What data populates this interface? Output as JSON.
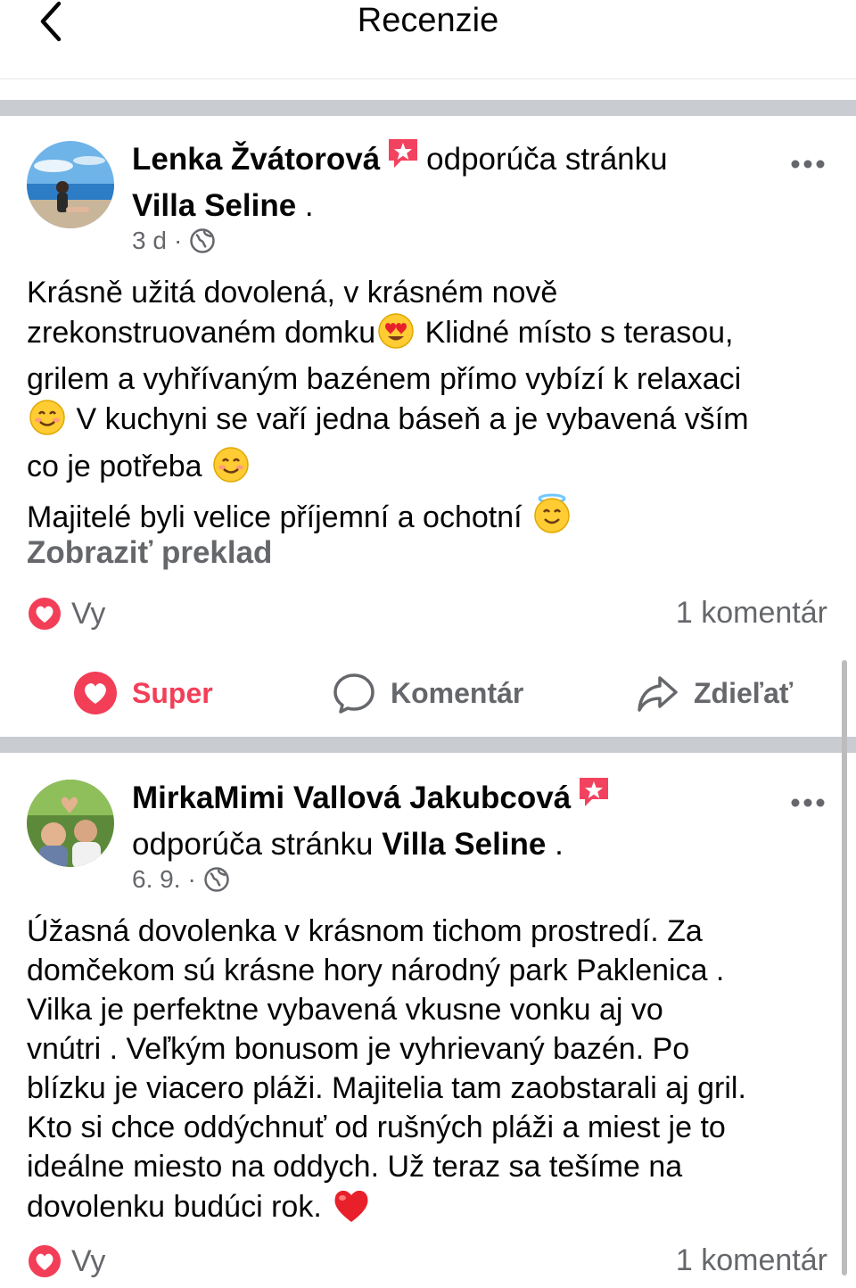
{
  "header": {
    "title": "Recenzie",
    "back_icon": "chevron-left-icon"
  },
  "colors": {
    "separator": "#c9ccd1",
    "love": "#f33e58",
    "muted": "#65676b",
    "badge": "#f3425f"
  },
  "posts": [
    {
      "author": "Lenka Žvátorová",
      "recommends_text": "odporúča stránku",
      "page_name": "Villa Seline",
      "page_suffix": ".",
      "time": "3 d",
      "dot": "·",
      "lines": [
        "Krásně užitá dovolená, v krásném nově",
        "zrekonstruovaném domku",
        " Klidné místo s terasou,",
        "grilem a vyhřívaným bazénem přímo vybízí k relaxaci",
        " V kuchyni se vaří jedna báseň a je vybavená vším",
        "co je potřeba ",
        "Majitelé byli velice příjemní a ochotní "
      ],
      "see_translation": "Zobraziť preklad",
      "reactions_label": "Vy",
      "comments_count": "1 komentár",
      "actions": {
        "like": "Super",
        "comment": "Komentár",
        "share": "Zdieľať"
      }
    },
    {
      "author": "MirkaMimi Vallová Jakubcová",
      "recommends_text": "odporúča stránku",
      "page_name": "Villa Seline",
      "page_suffix": ".",
      "time": "6. 9.",
      "dot": "·",
      "lines": [
        "Úžasná dovolenka v krásnom tichom  prostredí. Za",
        "domčekom sú krásne hory národný park Paklenica .",
        "Vilka je perfektne vybavená vkusne vonku aj vo",
        "vnútri . Veľkým bonusom je vyhrievaný bazén. Po",
        "blízku je viacero pláži. Majitelia tam zaobstarali aj gril.",
        "Kto si chce oddýchnuť od rušných pláži a miest je to",
        "ideálne miesto na oddych. Už teraz sa tešíme na",
        "dovolenku budúci rok. "
      ],
      "reactions_label": "Vy",
      "comments_count": "1 komentár"
    }
  ]
}
